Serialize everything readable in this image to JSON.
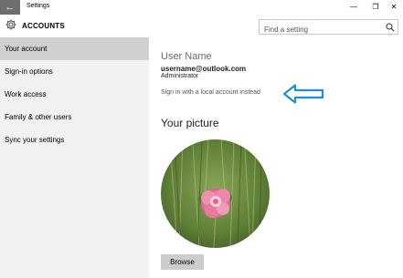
{
  "window": {
    "title": "Settings",
    "back_glyph": "←",
    "minimize_glyph": "—",
    "maximize_glyph": "❐",
    "close_glyph": "✕"
  },
  "header": {
    "icon": "gear-icon",
    "title": "ACCOUNTS"
  },
  "search": {
    "placeholder": "Find a setting",
    "icon": "search-icon"
  },
  "sidebar": {
    "items": [
      {
        "label": "Your account",
        "active": true
      },
      {
        "label": "Sign-in options",
        "active": false
      },
      {
        "label": "Work access",
        "active": false
      },
      {
        "label": "Family & other users",
        "active": false
      },
      {
        "label": "Sync your settings",
        "active": false
      }
    ]
  },
  "account": {
    "name": "User Name",
    "email": "username@outlook.com",
    "role": "Administrator",
    "local_account_link": "Sign in with a local account instead"
  },
  "picture": {
    "heading": "Your picture",
    "browse_label": "Browse"
  },
  "colors": {
    "accent_arrow": "#1e8fd6",
    "sidebar_bg": "#f2f2f2",
    "sidebar_active": "#d0d0d0"
  }
}
